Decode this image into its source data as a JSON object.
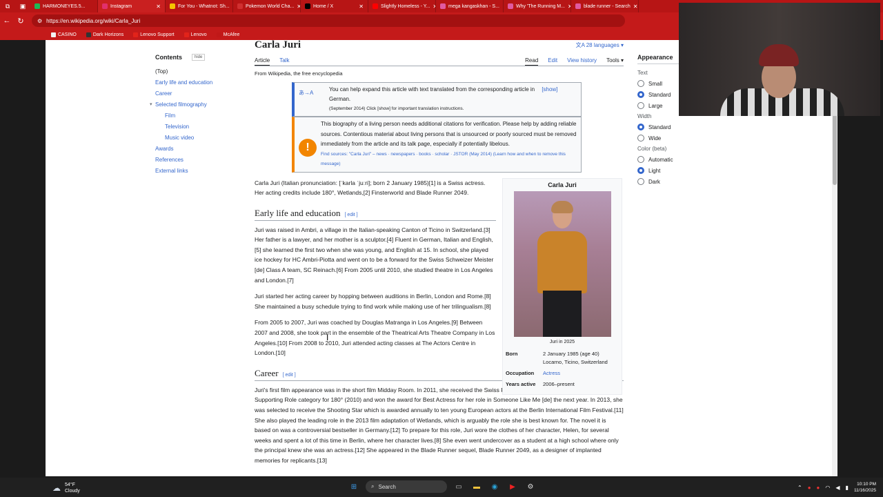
{
  "browser": {
    "tabs": [
      {
        "label": "HARMONEYES.5...",
        "color": "#f2f2f2"
      },
      {
        "label": "Instagram",
        "color": "#e1306c"
      },
      {
        "label": "For You - Whatnot: Sh...",
        "color": "#f5c400"
      },
      {
        "label": "Pokemon World Cha...",
        "color": "#d03030"
      },
      {
        "label": "Home / X",
        "color": "#000000"
      },
      {
        "label": "Slightly Homeless - Y...",
        "color": "#ff0000"
      },
      {
        "label": "mega kangaskhan - S...",
        "color": "#e05aa0"
      },
      {
        "label": "Why 'The Running M...",
        "color": "#e05aa0"
      },
      {
        "label": "blade runner - Search",
        "color": "#e05aa0"
      }
    ],
    "url": "https://en.wikipedia.org/wiki/Carla_Juri",
    "bookmarks": [
      {
        "label": "CASINO",
        "color": "#f2f2f2"
      },
      {
        "label": "Dark Horizons",
        "color": "#333333"
      },
      {
        "label": "Lenovo Support",
        "color": "#e2231a"
      },
      {
        "label": "Lenovo",
        "color": "#e2231a"
      },
      {
        "label": "McAfee",
        "color": "#c01818"
      }
    ]
  },
  "toc": {
    "title": "Contents",
    "hide": "hide",
    "items": [
      "(Top)",
      "Early life and education",
      "Career",
      "Selected filmography",
      "Film",
      "Television",
      "Music video",
      "Awards",
      "References",
      "External links"
    ]
  },
  "article": {
    "title": "Carla Juri",
    "languages": "28 languages",
    "tab_article": "Article",
    "tab_talk": "Talk",
    "tab_read": "Read",
    "tab_edit": "Edit",
    "tab_history": "View history",
    "tab_tools": "Tools",
    "tagline": "From Wikipedia, the free encyclopedia",
    "notice1_icon": "あ→A",
    "notice1_text": "You can help expand this article with text translated from the corresponding article in German.",
    "notice1_sub": "(September 2014) Click [show] for important translation instructions.",
    "notice1_show": "[show]",
    "notice2_text": "This biography of a living person needs additional citations for verification. Please help by adding reliable sources. Contentious material about living persons that is unsourced or poorly sourced must be removed immediately from the article and its talk page, especially if potentially libelous.",
    "notice2_sub": "Find sources: \"Carla Juri\" – news · newspapers · books · scholar · JSTOR (May 2014) (Learn how and when to remove this message)",
    "lead": "Carla Juri (Italian pronunciation: [ˈkarla ˈjuːri]; born 2 January 1985)[1] is a Swiss actress. Her acting credits include 180°, Wetlands,[2] Finsterworld and Blade Runner 2049.",
    "h_early": "Early life and education",
    "edit": "[ edit ]",
    "early_p1": "Juri was raised in Ambri, a village in the Italian-speaking Canton of Ticino in Switzerland.[3] Her father is a lawyer, and her mother is a sculptor.[4] Fluent in German, Italian and English,[5] she learned the first two when she was young, and English at 15. In school, she played ice hockey for HC Ambri-Piotta and went on to be a forward for the Swiss Schweizer Meister [de] Class A team, SC Reinach.[6] From 2005 until 2010, she studied theatre in Los Angeles and London.[7]",
    "early_p2": "Juri started her acting career by hopping between auditions in Berlin, London and Rome.[8] She maintained a busy schedule trying to find work while making use of her trilingualism.[8]",
    "early_p3": "From 2005 to 2007, Juri was coached by Douglas Matranga in Los Angeles.[9] Between 2007 and 2008, she took part in the ensemble of the Theatrical Arts Theatre Company in Los Angeles.[10] From 2008 to 2010, Juri attended acting classes at The Actors Centre in London.[10]",
    "h_career": "Career",
    "career_p1": "Juri's first film appearance was in the short film Midday Room. In 2011, she received the Swiss Film Award in the Best Performance in a Supporting Role category for 180° (2010) and won the award for Best Actress for her role in Someone Like Me [de] the next year. In 2013, she was selected to receive the Shooting Star which is awarded annually to ten young European actors at the Berlin International Film Festival.[11] She also played the leading role in the 2013 film adaptation of Wetlands, which is arguably the role she is best known for. The novel it is based on was a controversial bestseller in Germany.[12] To prepare for this role, Juri wore the clothes of her character, Helen, for several weeks and spent a lot of this time in Berlin, where her character lives.[8] She even went undercover as a student at a high school where only the principal knew she was an actress.[12] She appeared in the Blade Runner sequel, Blade Runner 2049, as a designer of implanted memories for replicants.[13]"
  },
  "infobox": {
    "caption": "Carla Juri",
    "photo_caption": "Juri in 2025",
    "born_k": "Born",
    "born_v": "2 January 1985 (age 40) Locarno, Ticino, Switzerland",
    "occ_k": "Occupation",
    "occ_v": "Actress",
    "years_k": "Years active",
    "years_v": "2006–present"
  },
  "appearance": {
    "title": "Appearance",
    "text_label": "Text",
    "text_options": [
      "Small",
      "Standard",
      "Large"
    ],
    "width_label": "Width",
    "width_options": [
      "Standard",
      "Wide"
    ],
    "color_label": "Color (beta)",
    "color_options": [
      "Automatic",
      "Light",
      "Dark"
    ]
  },
  "taskbar": {
    "temp": "54°F",
    "condition": "Cloudy",
    "search": "Search",
    "time": "10:10 PM",
    "date": "11/16/2025"
  }
}
